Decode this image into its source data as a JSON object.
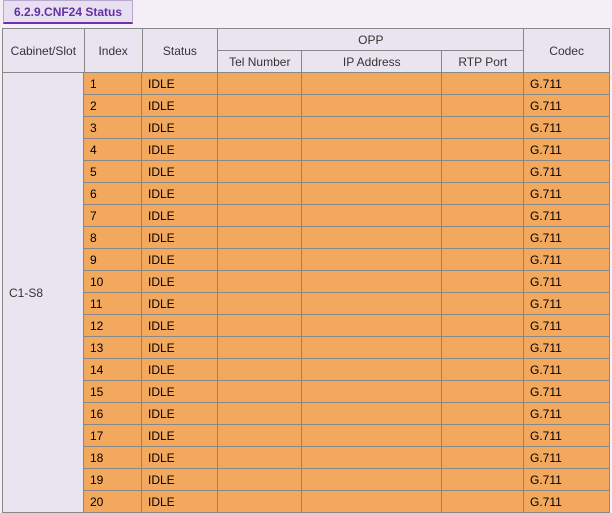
{
  "tab": {
    "label": "6.2.9.CNF24 Status"
  },
  "headers": {
    "cabinet_slot": "Cabinet/Slot",
    "index": "Index",
    "status": "Status",
    "opp": "OPP",
    "tel_number": "Tel Number",
    "ip_address": "IP Address",
    "rtp_port": "RTP Port",
    "codec": "Codec"
  },
  "cabinet_slot_value": "C1-S8",
  "rows": [
    {
      "index": "1",
      "status": "IDLE",
      "tel": "",
      "ip": "",
      "rtp": "",
      "codec": "G.711"
    },
    {
      "index": "2",
      "status": "IDLE",
      "tel": "",
      "ip": "",
      "rtp": "",
      "codec": "G.711"
    },
    {
      "index": "3",
      "status": "IDLE",
      "tel": "",
      "ip": "",
      "rtp": "",
      "codec": "G.711"
    },
    {
      "index": "4",
      "status": "IDLE",
      "tel": "",
      "ip": "",
      "rtp": "",
      "codec": "G.711"
    },
    {
      "index": "5",
      "status": "IDLE",
      "tel": "",
      "ip": "",
      "rtp": "",
      "codec": "G.711"
    },
    {
      "index": "6",
      "status": "IDLE",
      "tel": "",
      "ip": "",
      "rtp": "",
      "codec": "G.711"
    },
    {
      "index": "7",
      "status": "IDLE",
      "tel": "",
      "ip": "",
      "rtp": "",
      "codec": "G.711"
    },
    {
      "index": "8",
      "status": "IDLE",
      "tel": "",
      "ip": "",
      "rtp": "",
      "codec": "G.711"
    },
    {
      "index": "9",
      "status": "IDLE",
      "tel": "",
      "ip": "",
      "rtp": "",
      "codec": "G.711"
    },
    {
      "index": "10",
      "status": "IDLE",
      "tel": "",
      "ip": "",
      "rtp": "",
      "codec": "G.711"
    },
    {
      "index": "11",
      "status": "IDLE",
      "tel": "",
      "ip": "",
      "rtp": "",
      "codec": "G.711"
    },
    {
      "index": "12",
      "status": "IDLE",
      "tel": "",
      "ip": "",
      "rtp": "",
      "codec": "G.711"
    },
    {
      "index": "13",
      "status": "IDLE",
      "tel": "",
      "ip": "",
      "rtp": "",
      "codec": "G.711"
    },
    {
      "index": "14",
      "status": "IDLE",
      "tel": "",
      "ip": "",
      "rtp": "",
      "codec": "G.711"
    },
    {
      "index": "15",
      "status": "IDLE",
      "tel": "",
      "ip": "",
      "rtp": "",
      "codec": "G.711"
    },
    {
      "index": "16",
      "status": "IDLE",
      "tel": "",
      "ip": "",
      "rtp": "",
      "codec": "G.711"
    },
    {
      "index": "17",
      "status": "IDLE",
      "tel": "",
      "ip": "",
      "rtp": "",
      "codec": "G.711"
    },
    {
      "index": "18",
      "status": "IDLE",
      "tel": "",
      "ip": "",
      "rtp": "",
      "codec": "G.711"
    },
    {
      "index": "19",
      "status": "IDLE",
      "tel": "",
      "ip": "",
      "rtp": "",
      "codec": "G.711"
    },
    {
      "index": "20",
      "status": "IDLE",
      "tel": "",
      "ip": "",
      "rtp": "",
      "codec": "G.711"
    }
  ]
}
